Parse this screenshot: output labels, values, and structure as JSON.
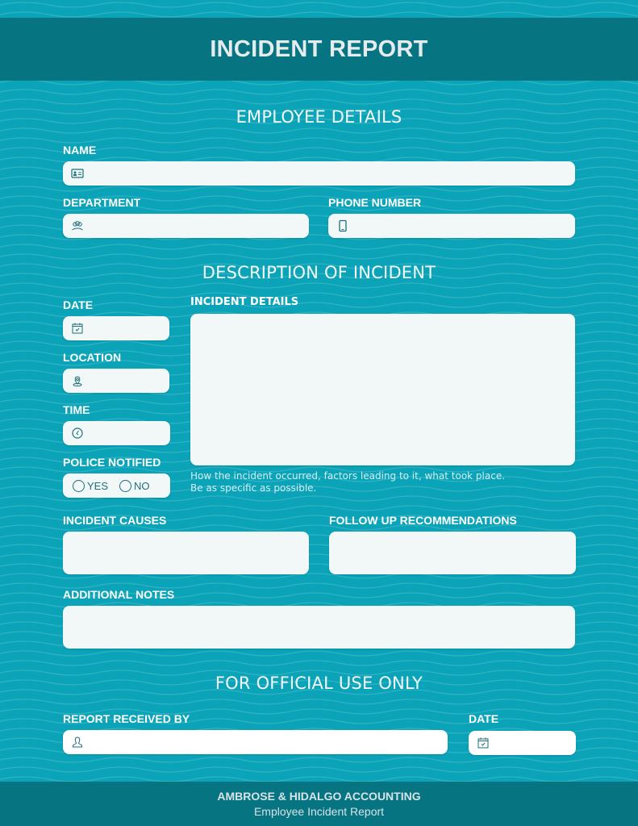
{
  "header": {
    "title": "INCIDENT REPORT"
  },
  "colors": {
    "background": "#0aa3b8",
    "header_bar": "#077482",
    "field": "#f2f7f7",
    "icon": "#1d6f7b"
  },
  "employee_details": {
    "heading": "EMPLOYEE DETAILS",
    "name": {
      "label": "NAME",
      "value": "",
      "icon": "id-card-icon"
    },
    "department": {
      "label": "DEPARTMENT",
      "value": "",
      "icon": "group-icon"
    },
    "phone": {
      "label": "PHONE NUMBER",
      "value": "",
      "icon": "phone-icon"
    }
  },
  "description": {
    "heading": "DESCRIPTION OF INCIDENT",
    "date": {
      "label": "DATE",
      "value": "",
      "icon": "calendar-icon"
    },
    "location": {
      "label": "LOCATION",
      "value": "",
      "icon": "location-pin-icon"
    },
    "time": {
      "label": "TIME",
      "value": "",
      "icon": "clock-icon"
    },
    "police_notified": {
      "label": "POLICE NOTIFIED",
      "options": [
        "YES",
        "NO"
      ],
      "selected": null
    },
    "incident_details": {
      "label": "INCIDENT DETAILS",
      "value": "",
      "hint_line1": "How the incident occurred, factors leading to it, what took place.",
      "hint_line2": "Be as specific as possible."
    },
    "incident_causes": {
      "label": "INCIDENT CAUSES",
      "value": ""
    },
    "follow_up": {
      "label": "FOLLOW UP RECOMMENDATIONS",
      "value": ""
    },
    "additional_notes": {
      "label": "ADDITIONAL NOTES",
      "value": ""
    }
  },
  "official": {
    "heading": "FOR OFFICIAL USE ONLY",
    "received_by": {
      "label": "REPORT RECEIVED BY",
      "value": "",
      "icon": "person-icon"
    },
    "date": {
      "label": "DATE",
      "value": "",
      "icon": "calendar-icon"
    }
  },
  "footer": {
    "org": "AMBROSE & HIDALGO ACCOUNTING",
    "subtitle": "Employee Incident Report"
  }
}
